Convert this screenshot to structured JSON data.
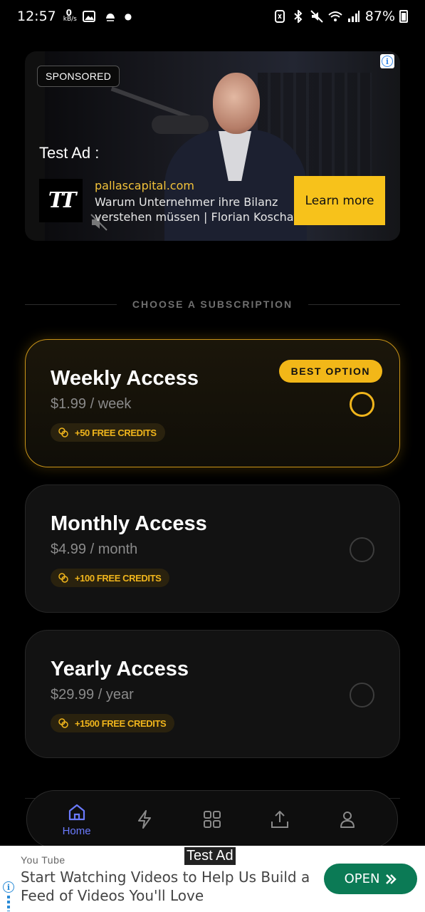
{
  "status_bar": {
    "time": "12:57",
    "net_speed_value": "0",
    "net_speed_unit": "kB/s",
    "battery": "87%"
  },
  "ad": {
    "sponsored_label": "SPONSORED",
    "test_label": "Test Ad :",
    "domain": "pallascapital.com",
    "headline": "Warum Unternehmer ihre Bilanz verstehen müssen | Florian Koschat",
    "logo_text": "TT",
    "cta": "Learn more"
  },
  "section_title": "CHOOSE A SUBSCRIPTION",
  "plans": [
    {
      "name": "Weekly Access",
      "price": "$1.99 / week",
      "credits": "+50 FREE CREDITS",
      "badge": "BEST OPTION",
      "selected": true
    },
    {
      "name": "Monthly Access",
      "price": "$4.99 / month",
      "credits": "+100 FREE CREDITS",
      "selected": false
    },
    {
      "name": "Yearly Access",
      "price": "$29.99 / year",
      "credits": "+1500 FREE CREDITS",
      "selected": false
    }
  ],
  "nav": {
    "home_label": "Home",
    "items": [
      "home-icon",
      "lightning-icon",
      "grid-icon",
      "upload-icon",
      "user-icon"
    ],
    "active_color": "#6b7bff"
  },
  "banner": {
    "tag": "Test Ad",
    "source": "You Tube",
    "text": "Start Watching Videos to Help Us Build a Feed of Videos You'll Love",
    "cta": "OPEN"
  },
  "colors": {
    "accent": "#f2b718",
    "cta_yellow": "#f7c21b",
    "open_green": "#0b7a55"
  }
}
